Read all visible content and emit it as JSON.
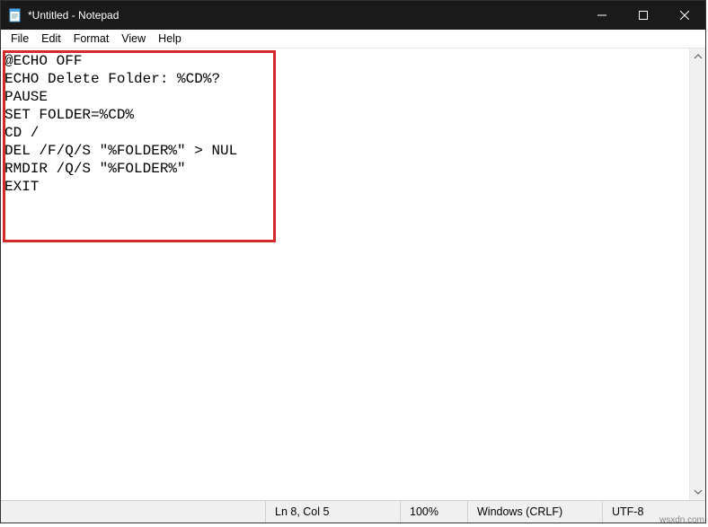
{
  "titlebar": {
    "title": "*Untitled - Notepad"
  },
  "menubar": {
    "items": [
      "File",
      "Edit",
      "Format",
      "View",
      "Help"
    ]
  },
  "editor": {
    "content": "@ECHO OFF\nECHO Delete Folder: %CD%?\nPAUSE\nSET FOLDER=%CD%\nCD /\nDEL /F/Q/S \"%FOLDER%\" > NUL\nRMDIR /Q/S \"%FOLDER%\"\nEXIT"
  },
  "statusbar": {
    "position": "Ln 8, Col 5",
    "zoom": "100%",
    "eol": "Windows (CRLF)",
    "encoding": "UTF-8"
  },
  "watermark": "wsxdn.com"
}
